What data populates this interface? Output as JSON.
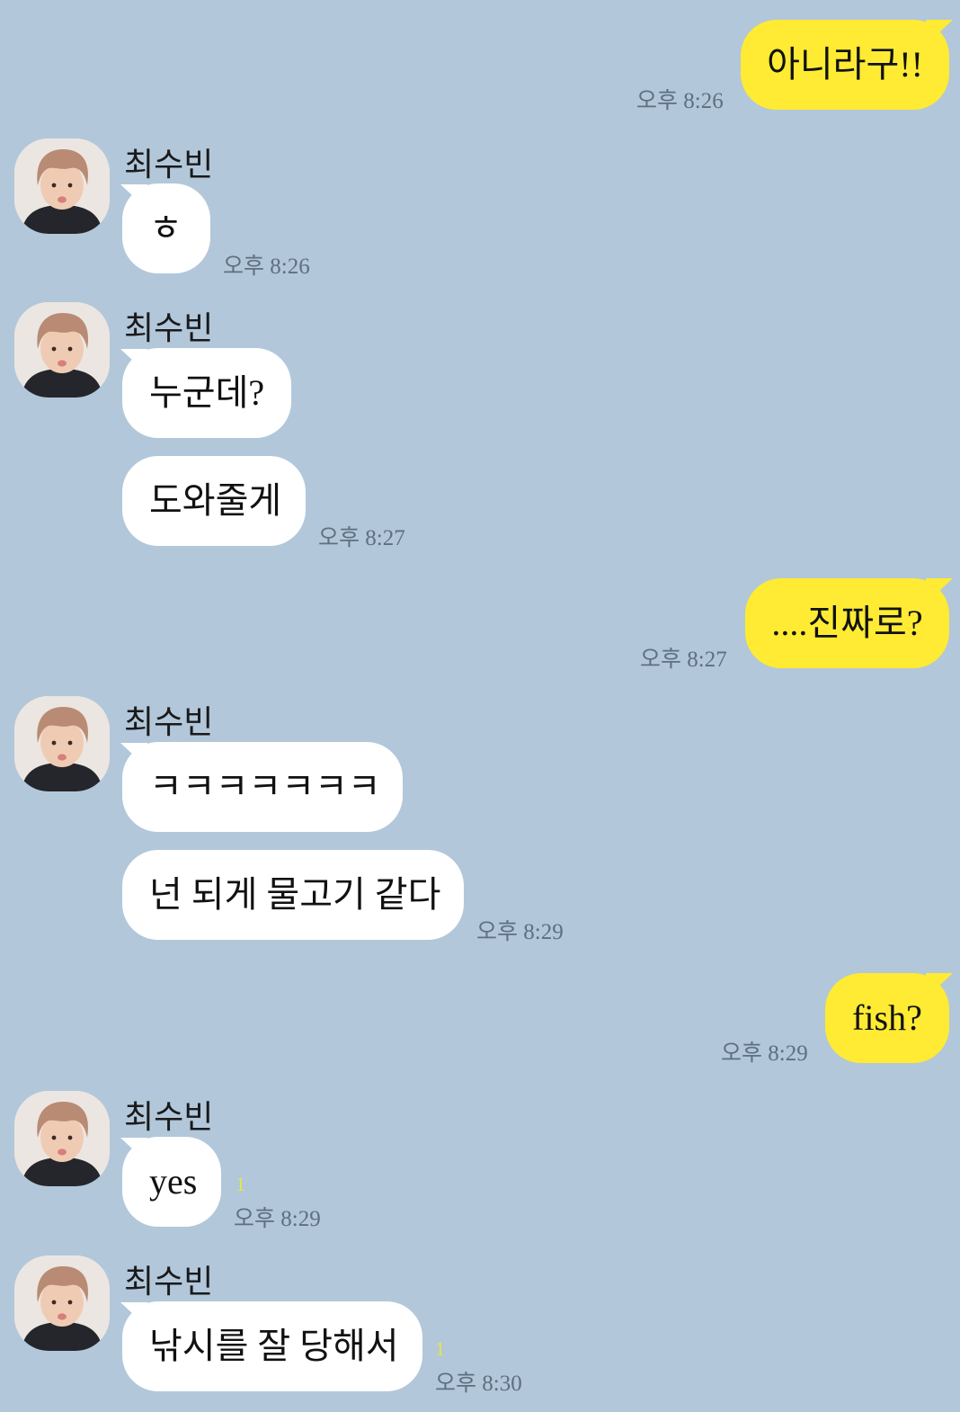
{
  "theme": {
    "background": "#b2c7da",
    "my_bubble": "#ffeb33",
    "their_bubble": "#ffffff",
    "timestamp_color": "#5f6f7f",
    "unread_color": "#e9e44a"
  },
  "contact": {
    "name": "최수빈",
    "avatar_icon": "profile-photo-avatar"
  },
  "messages": [
    {
      "from": "me",
      "text": "아니라구!!",
      "time": "오후 8:26"
    },
    {
      "from": "them",
      "sender": "최수빈",
      "text": "ㅎ",
      "time": "오후 8:26"
    },
    {
      "from": "them",
      "sender": "최수빈",
      "text": "누군데?"
    },
    {
      "from": "them",
      "text": "도와줄게",
      "time": "오후 8:27"
    },
    {
      "from": "me",
      "text": "....진짜로?",
      "time": "오후 8:27"
    },
    {
      "from": "them",
      "sender": "최수빈",
      "text": "ㅋㅋㅋㅋㅋㅋㅋ"
    },
    {
      "from": "them",
      "text": "넌 되게 물고기 같다",
      "time": "오후 8:29"
    },
    {
      "from": "me",
      "text": "fish?",
      "time": "오후 8:29"
    },
    {
      "from": "them",
      "sender": "최수빈",
      "text": "yes",
      "time": "오후 8:29",
      "unread": "1"
    },
    {
      "from": "them",
      "sender": "최수빈",
      "text": "낚시를 잘 당해서",
      "time": "오후 8:30",
      "unread": "1"
    }
  ]
}
